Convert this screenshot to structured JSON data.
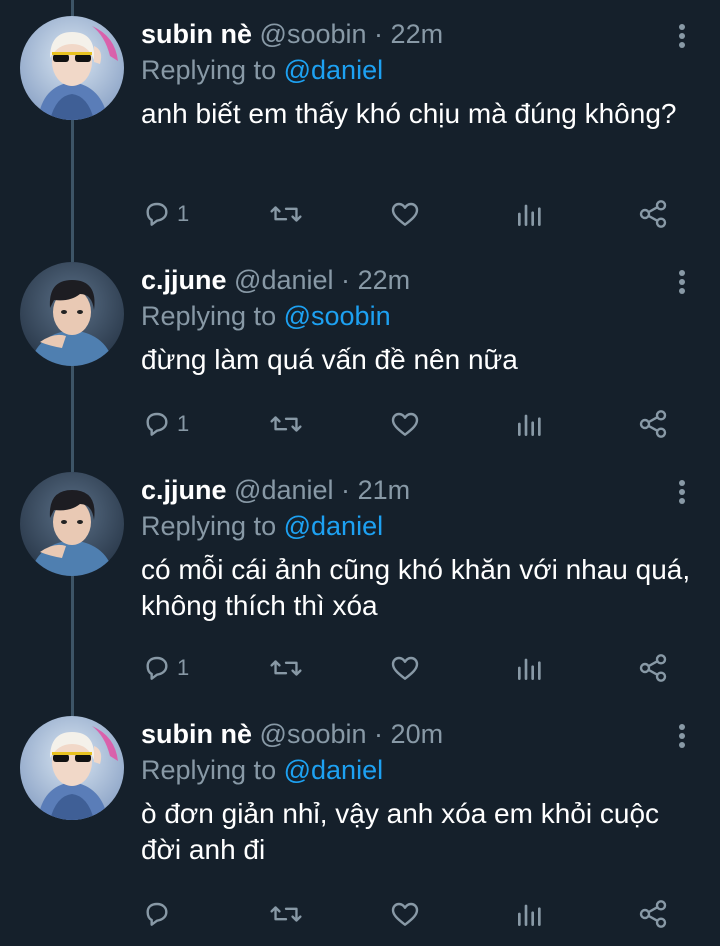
{
  "tweets": [
    {
      "name": "subin nè",
      "handle": "@soobin",
      "sep": "·",
      "time": "22m",
      "replying_prefix": "Replying to",
      "replying_to": "@daniel",
      "text": "anh biết em thấy khó chịu mà đúng không?",
      "reply_count": "1",
      "avatar": "avatar-soobin"
    },
    {
      "name": "c.jjune",
      "handle": "@daniel",
      "sep": "·",
      "time": "22m",
      "replying_prefix": "Replying to",
      "replying_to": "@soobin",
      "text": "đừng làm quá vấn đề nên nữa",
      "reply_count": "1",
      "avatar": "avatar-daniel"
    },
    {
      "name": "c.jjune",
      "handle": "@daniel",
      "sep": "·",
      "time": "21m",
      "replying_prefix": "Replying to",
      "replying_to": "@daniel",
      "text": "có mỗi cái ảnh cũng khó khăn với nhau quá, không thích thì xóa",
      "reply_count": "1",
      "avatar": "avatar-daniel"
    },
    {
      "name": "subin nè",
      "handle": "@soobin",
      "sep": "·",
      "time": "20m",
      "replying_prefix": "Replying to",
      "replying_to": "@daniel",
      "text": "ò đơn giản nhỉ, vậy anh xóa em khỏi cuộc đời anh đi",
      "reply_count": "",
      "avatar": "avatar-soobin"
    }
  ],
  "colors": {
    "background": "#15202b",
    "text": "#ffffff",
    "secondary": "#8899a6",
    "link": "#1da1f2",
    "thread_line": "#3d5466"
  },
  "icons": [
    "reply-icon",
    "retweet-icon",
    "like-icon",
    "analytics-icon",
    "share-icon",
    "more-options-icon"
  ]
}
